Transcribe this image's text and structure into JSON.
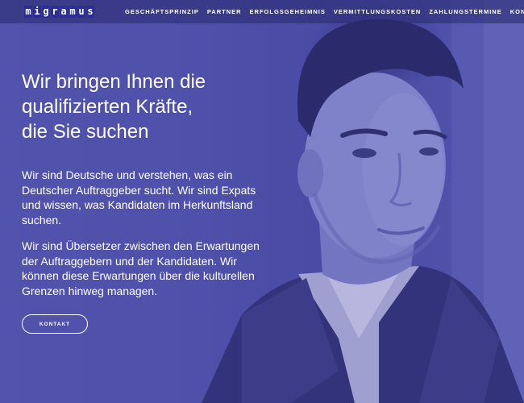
{
  "brand": {
    "logo_letters": [
      "m",
      "i",
      "g",
      "r",
      "a",
      "m",
      "u",
      "s"
    ]
  },
  "nav": {
    "items": [
      {
        "label": "GESCHÄFTSPRINZIP"
      },
      {
        "label": "PARTNER"
      },
      {
        "label": "ERFOLGSGEHEIMNIS"
      },
      {
        "label": "VERMITTLUNGSKOSTEN"
      },
      {
        "label": "ZAHLUNGSTERMINE"
      },
      {
        "label": "KONTAKT"
      }
    ]
  },
  "hero": {
    "headline_lines": [
      "Wir bringen Ihnen die",
      "qualifizierten Kräfte,",
      "die Sie suchen"
    ],
    "paragraph1": "Wir sind Deutsche und verstehen, was ein Deutscher Auftraggeber sucht. Wir sind Expats und wissen, was Kandidaten im Herkunftsland suchen.",
    "paragraph2": "Wir sind Übersetzer zwischen den Erwartungen der Auftraggebern und der Kandidaten. Wir können diese Erwartungen über die kulturellen Grenzen hinweg managen.",
    "cta_label": "KONTAKT"
  },
  "colors": {
    "tint": "#4a4ba2",
    "logo_box": "#2c2f8f",
    "text": "#ffffff"
  }
}
